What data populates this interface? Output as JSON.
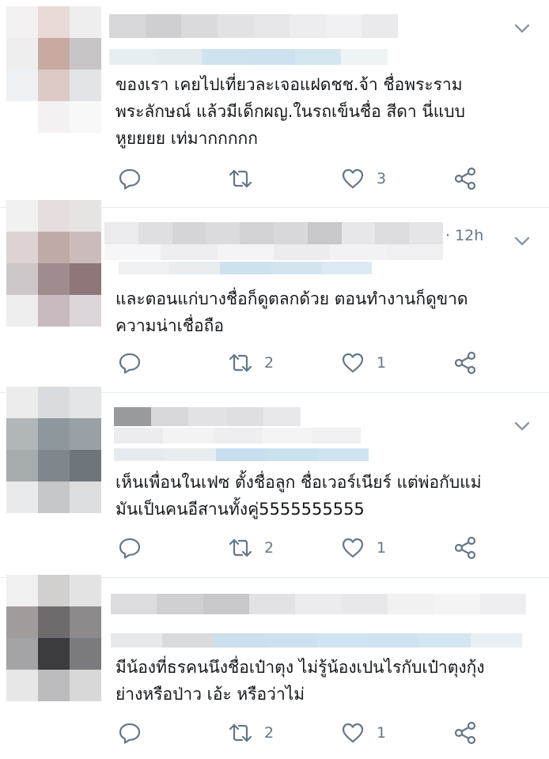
{
  "tweets": [
    {
      "time": "",
      "text": "ของเรา เคยไปเที่ยวละเจอแฝดชช.จ้า ชื่อพระราม\nพระลักษณ์ แล้วมีเด็กผญ.ในรถเข็นชื่อ สีดา นี่แบบ\nหูยยยย เท่มากกกกก",
      "retweets": "",
      "likes": "3"
    },
    {
      "time": "· 12h",
      "text": "และตอนแก่บางชื่อก็ดูตลกด้วย ตอนทำงานก็ดูขาด\nความน่าเชื่อถือ",
      "retweets": "2",
      "likes": "1"
    },
    {
      "time": "",
      "text": "เห็นเพื่อนในเฟซ ตั้งชื่อลูก ชื่อเวอร์เนียร์ แต่พ่อกับแม่\nมันเป็นคนอีสานทั้งคู่5555555555",
      "retweets": "2",
      "likes": "1"
    },
    {
      "time": "",
      "text": "มีน้องที่ธรคนนึงชื่อเป๋าตุง ไม่รู้น้องเปนไรกับเป๋าตุงกุ้ง\nย่างหรือป่าว เอ้ะ หรือว่าไม่",
      "retweets": "2",
      "likes": "1"
    }
  ],
  "icons": {
    "reply": "reply-icon",
    "retweet": "retweet-icon",
    "like": "heart-icon",
    "share": "share-icon",
    "more": "chevron-down-icon"
  },
  "colors": {
    "icon": "#657786",
    "divider": "#e6ecf0",
    "text": "#14171a"
  }
}
